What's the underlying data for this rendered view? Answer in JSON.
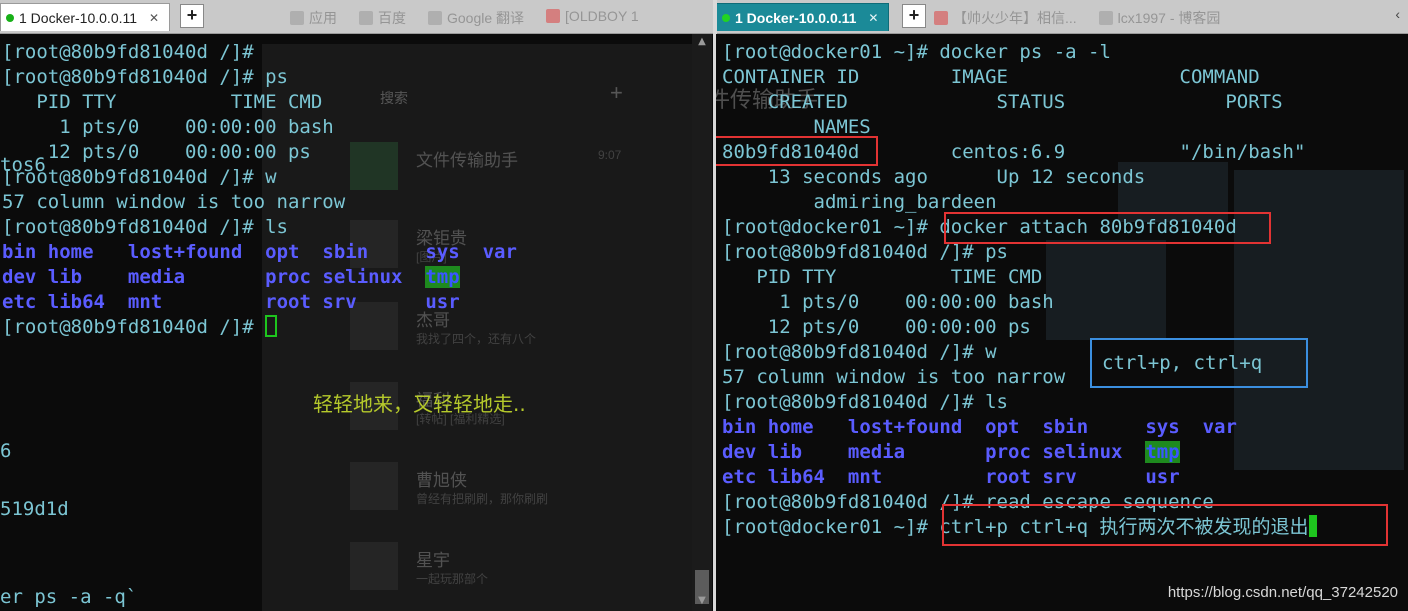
{
  "left_tabbar": {
    "tab_label": "1 Docker-10.0.0.11",
    "add_tab": "+",
    "bookmarks": [
      "应用",
      "百度",
      "Google 翻译",
      "[OLDBOY 1"
    ]
  },
  "right_tabbar": {
    "tab_label": "1 Docker-10.0.0.11",
    "add_tab": "+",
    "bookmarks": [
      "【帅火少年】相信...",
      "lcx1997 - 博客园"
    ],
    "min_label": "‹"
  },
  "left_terminal": {
    "lines": [
      "[root@80b9fd81040d /]#",
      "[root@80b9fd81040d /]# ps",
      "   PID TTY          TIME CMD",
      "     1 pts/0    00:00:00 bash",
      "    12 pts/0    00:00:00 ps",
      "[root@80b9fd81040d /]# w",
      "57 column window is too narrow",
      "[root@80b9fd81040d /]# ls"
    ],
    "ls_rows": [
      [
        "bin",
        "home",
        "lost+found",
        "opt",
        "sbin",
        "sys",
        "var"
      ],
      [
        "dev",
        "lib",
        "media",
        "proc",
        "selinux",
        "tmp",
        ""
      ],
      [
        "etc",
        "lib64",
        "mnt",
        "root",
        "srv",
        "usr",
        ""
      ]
    ],
    "prompt_last": "[root@80b9fd81040d /]# ",
    "fragments": [
      "tos6",
      "6",
      "519d1d",
      "er ps -a -q`"
    ],
    "overlay_text": "轻轻地来，又轻轻地走.."
  },
  "background_app": {
    "search_placeholder": "搜索",
    "contacts": [
      {
        "name": "文件传输助手",
        "time": "9:07"
      },
      {
        "name": "梁钜贵",
        "preview": "[图片]"
      },
      {
        "name": "杰哥",
        "preview": "我找了四个，还有八个"
      },
      {
        "name": "福利",
        "preview": "[转帖] [福利精选]"
      },
      {
        "name": "曹旭侠",
        "preview": "曾经有把刷刷，那你刷刷"
      },
      {
        "name": "星宇",
        "preview": "一起玩那部个"
      }
    ],
    "chat_title": "文件传输助手"
  },
  "right_terminal": {
    "lines": [
      "[root@docker01 ~]# docker ps -a -l",
      "CONTAINER ID        IMAGE               COMMAND",
      "    CREATED             STATUS              PORTS",
      "        NAMES",
      "80b9fd81040d        centos:6.9          \"/bin/bash\"",
      "    13 seconds ago      Up 12 seconds",
      "        admiring_bardeen",
      "[root@docker01 ~]# docker attach 80b9fd81040d",
      "[root@80b9fd81040d /]# ps",
      "   PID TTY          TIME CMD",
      "     1 pts/0    00:00:00 bash",
      "    12 pts/0    00:00:00 ps",
      "[root@80b9fd81040d /]# w",
      "57 column window is too narrow",
      "[root@80b9fd81040d /]# ls"
    ],
    "ls_rows": [
      [
        "bin",
        "home",
        "lost+found",
        "opt",
        "sbin",
        "sys",
        "var"
      ],
      [
        "dev",
        "lib",
        "media",
        "proc",
        "selinux",
        "tmp",
        ""
      ],
      [
        "etc",
        "lib64",
        "mnt",
        "root",
        "srv",
        "usr",
        ""
      ]
    ],
    "escape_line": "[root@80b9fd81040d /]# read escape sequence",
    "last_prompt": "[root@docker01 ~]# ",
    "last_command": "ctrl+p ctrl+q 执行两次不被发现的退出",
    "blue_annotation": "ctrl+p, ctrl+q"
  },
  "watermark": "https://blog.csdn.net/qq_37242520",
  "colors": {
    "terminal_text": "#7cc6d4",
    "directory": "#5a5cff",
    "annotation_red": "#e23333",
    "annotation_blue": "#3b8fe0",
    "cursor": "#1ec51e"
  }
}
